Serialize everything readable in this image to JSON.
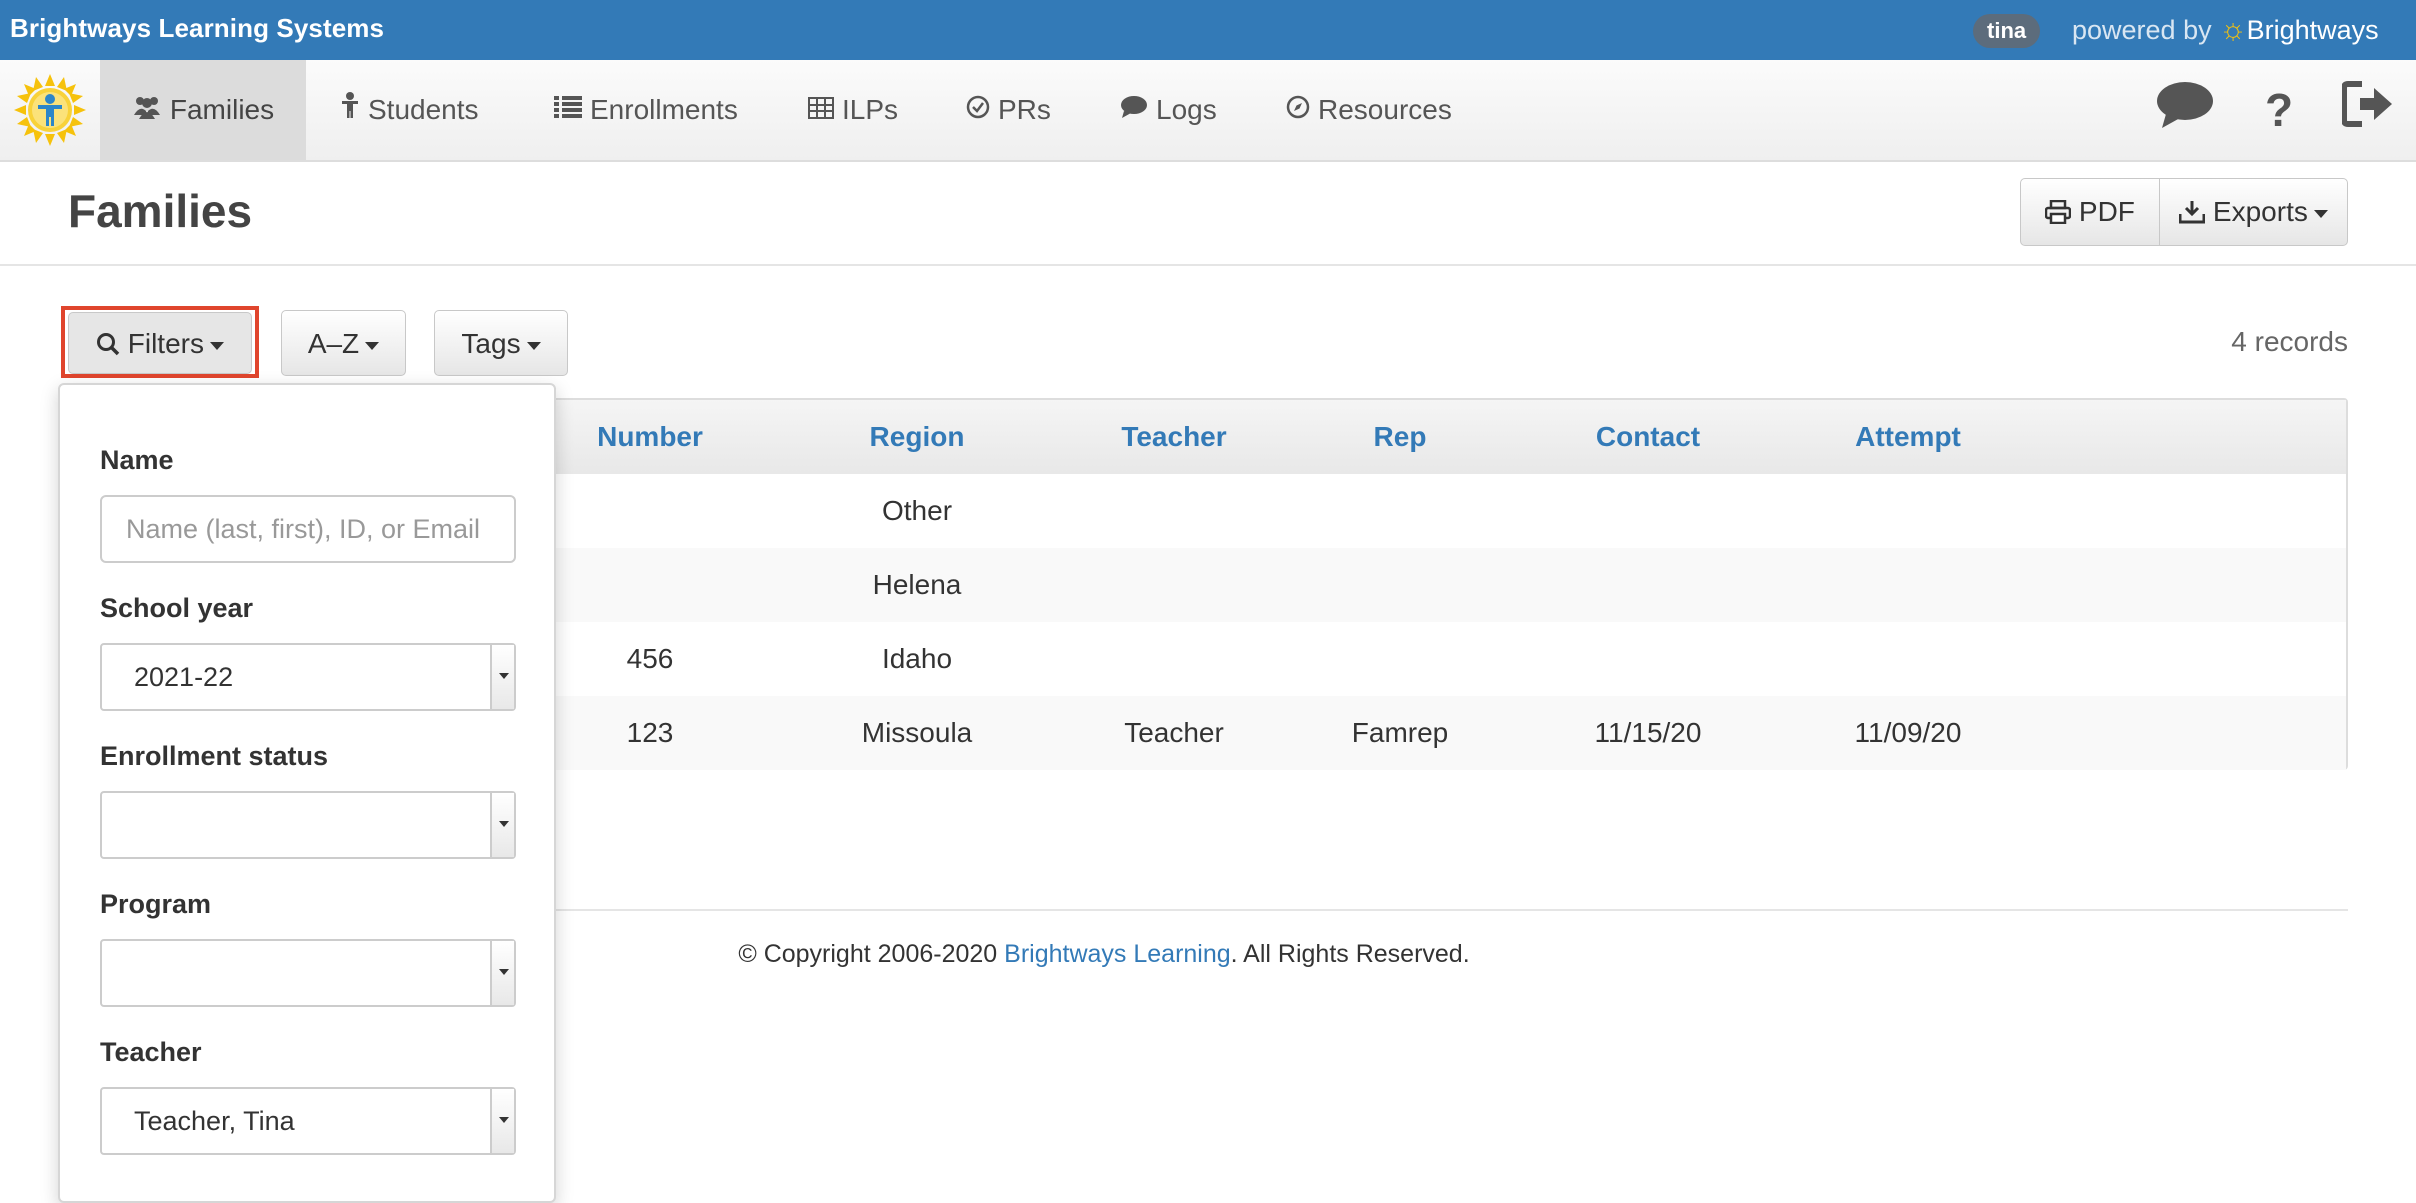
{
  "topbar": {
    "brand": "Brightways Learning Systems",
    "user": "tina",
    "powered_prefix": "powered by",
    "powered_brand": "Brightways"
  },
  "nav": {
    "items": [
      {
        "label": "Families",
        "icon": "users-icon",
        "active": true
      },
      {
        "label": "Students",
        "icon": "child-icon",
        "active": false
      },
      {
        "label": "Enrollments",
        "icon": "list-icon",
        "active": false
      },
      {
        "label": "ILPs",
        "icon": "table-icon",
        "active": false
      },
      {
        "label": "PRs",
        "icon": "check-circle-icon",
        "active": false
      },
      {
        "label": "Logs",
        "icon": "comment-icon",
        "active": false
      },
      {
        "label": "Resources",
        "icon": "compass-icon",
        "active": false
      }
    ],
    "right_icons": [
      "chat-icon",
      "help-icon",
      "logout-icon"
    ]
  },
  "page": {
    "title": "Families",
    "pdf_label": "PDF",
    "exports_label": "Exports"
  },
  "toolbar": {
    "filters_label": "Filters",
    "az_label": "A–Z",
    "tags_label": "Tags",
    "records": "4 records"
  },
  "table": {
    "columns": [
      "Number",
      "Region",
      "Teacher",
      "Rep",
      "Contact",
      "Attempt"
    ],
    "rows": [
      [
        "",
        "Other",
        "",
        "",
        "",
        ""
      ],
      [
        "",
        "Helena",
        "",
        "",
        "",
        ""
      ],
      [
        "456",
        "Idaho",
        "",
        "",
        "",
        ""
      ],
      [
        "123",
        "Missoula",
        "Teacher",
        "Famrep",
        "11/15/20",
        "11/09/20"
      ]
    ]
  },
  "footer": {
    "prefix": "© Copyright 2006-2020 ",
    "link": "Brightways Learning",
    "suffix": ". All Rights Reserved."
  },
  "filters": {
    "name_label": "Name",
    "name_placeholder": "Name (last, first), ID, or Email",
    "name_value": "",
    "school_year_label": "School year",
    "school_year_value": "2021-22",
    "enrollment_status_label": "Enrollment status",
    "enrollment_status_value": "",
    "program_label": "Program",
    "program_value": "",
    "teacher_label": "Teacher",
    "teacher_value": "Teacher, Tina"
  },
  "colors": {
    "topbar": "#337ab7",
    "link": "#337ab7",
    "highlight": "#e0452d",
    "sun": "#f6c20c"
  }
}
